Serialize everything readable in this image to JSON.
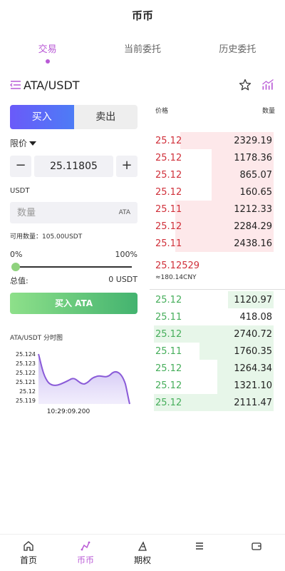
{
  "header": {
    "title": "币币"
  },
  "tabs": [
    {
      "label": "交易",
      "active": true
    },
    {
      "label": "当前委托",
      "active": false
    },
    {
      "label": "历史委托",
      "active": false
    }
  ],
  "pair": {
    "name": "ATA/USDT"
  },
  "trade": {
    "buy_label": "买入",
    "sell_label": "卖出",
    "order_type": "限价",
    "price_value": "25.11805",
    "minus": "−",
    "plus": "+",
    "unit_label": "USDT",
    "qty_placeholder": "数量",
    "qty_unit": "ATA",
    "available": "可用数量：105.00USDT",
    "pct_min": "0%",
    "pct_max": "100%",
    "slider_level": 0,
    "total_label": "总值:",
    "total_value": "0 USDT",
    "submit_label": "买入 ATA"
  },
  "mini_chart": {
    "title": "ATA/USDT 分时图",
    "y_ticks": [
      "25.124",
      "25.123",
      "25.122",
      "25.121",
      "25.12",
      "25.119"
    ],
    "x_label": "10:29:09.200",
    "line_color": "#8a5bd8"
  },
  "orderbook": {
    "price_header": "价格",
    "qty_header": "数量",
    "asks": [
      {
        "price": "25.12",
        "qty": "2329.19",
        "depth": 0.78
      },
      {
        "price": "25.12",
        "qty": "1178.36",
        "depth": 0.52
      },
      {
        "price": "25.12",
        "qty": "865.07",
        "depth": 0.52
      },
      {
        "price": "25.12",
        "qty": "160.65",
        "depth": 0.52
      },
      {
        "price": "25.11",
        "qty": "1212.33",
        "depth": 0.82
      },
      {
        "price": "25.12",
        "qty": "2284.29",
        "depth": 0.82
      },
      {
        "price": "25.11",
        "qty": "2438.16",
        "depth": 0.82
      }
    ],
    "last_price": "25.12529",
    "last_cny": "≈180.14CNY",
    "bids": [
      {
        "price": "25.12",
        "qty": "1120.97",
        "depth": 0.38
      },
      {
        "price": "25.11",
        "qty": "418.08",
        "depth": 0.0
      },
      {
        "price": "25.12",
        "qty": "2740.72",
        "depth": 1.0
      },
      {
        "price": "25.11",
        "qty": "1760.35",
        "depth": 0.62
      },
      {
        "price": "25.12",
        "qty": "1264.34",
        "depth": 0.47
      },
      {
        "price": "25.12",
        "qty": "1321.10",
        "depth": 0.47
      },
      {
        "price": "25.12",
        "qty": "2111.47",
        "depth": 1.0
      }
    ]
  },
  "nav": [
    {
      "label": "首页",
      "icon": "home-icon",
      "active": false
    },
    {
      "label": "币币",
      "icon": "coin-trade-icon",
      "active": true
    },
    {
      "label": "期权",
      "icon": "options-icon",
      "active": false
    },
    {
      "label": "",
      "icon": "list-icon",
      "active": false
    },
    {
      "label": "",
      "icon": "wallet-icon",
      "active": false
    }
  ],
  "colors": {
    "accent": "#b95ad6",
    "ask": "#d0303a",
    "bid": "#46ae5b",
    "buy_gradient_start": "#6a5af9",
    "buy_gradient_end": "#4d7cf6"
  }
}
